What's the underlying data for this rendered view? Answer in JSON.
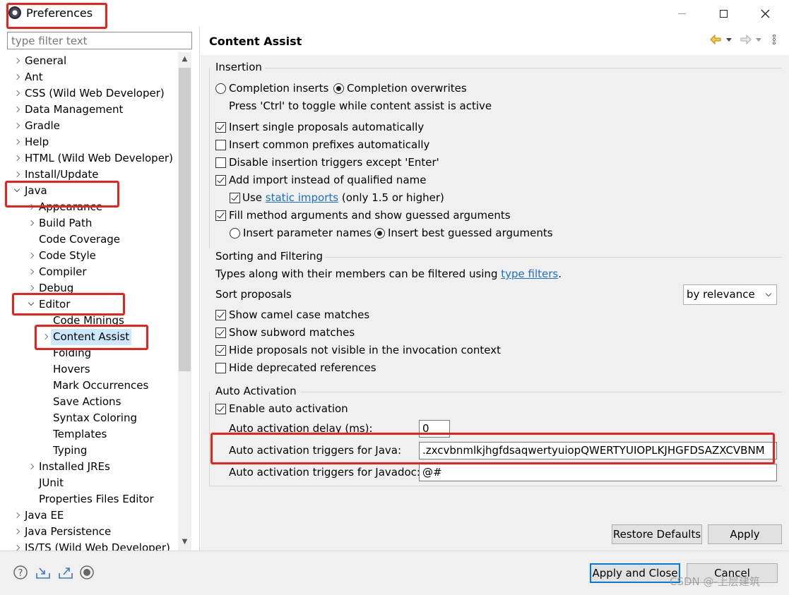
{
  "window": {
    "title": "Preferences",
    "minimize_icon": "minimize-icon",
    "maximize_icon": "maximize-icon",
    "close_icon": "close-icon"
  },
  "filter": {
    "placeholder": "type filter text",
    "value": ""
  },
  "tree": [
    {
      "label": "General",
      "level": 0,
      "toggle": "closed"
    },
    {
      "label": "Ant",
      "level": 0,
      "toggle": "closed"
    },
    {
      "label": "CSS (Wild Web Developer)",
      "level": 0,
      "toggle": "closed"
    },
    {
      "label": "Data Management",
      "level": 0,
      "toggle": "closed"
    },
    {
      "label": "Gradle",
      "level": 0,
      "toggle": "closed"
    },
    {
      "label": "Help",
      "level": 0,
      "toggle": "closed"
    },
    {
      "label": "HTML (Wild Web Developer)",
      "level": 0,
      "toggle": "closed"
    },
    {
      "label": "Install/Update",
      "level": 0,
      "toggle": "closed"
    },
    {
      "label": "Java",
      "level": 0,
      "toggle": "open"
    },
    {
      "label": "Appearance",
      "level": 1,
      "toggle": "closed"
    },
    {
      "label": "Build Path",
      "level": 1,
      "toggle": "closed"
    },
    {
      "label": "Code Coverage",
      "level": 1,
      "toggle": "none"
    },
    {
      "label": "Code Style",
      "level": 1,
      "toggle": "closed"
    },
    {
      "label": "Compiler",
      "level": 1,
      "toggle": "closed"
    },
    {
      "label": "Debug",
      "level": 1,
      "toggle": "closed"
    },
    {
      "label": "Editor",
      "level": 1,
      "toggle": "open"
    },
    {
      "label": "Code Minings",
      "level": 2,
      "toggle": "none"
    },
    {
      "label": "Content Assist",
      "level": 2,
      "toggle": "closed",
      "selected": true
    },
    {
      "label": "Folding",
      "level": 2,
      "toggle": "none"
    },
    {
      "label": "Hovers",
      "level": 2,
      "toggle": "none"
    },
    {
      "label": "Mark Occurrences",
      "level": 2,
      "toggle": "none"
    },
    {
      "label": "Save Actions",
      "level": 2,
      "toggle": "none"
    },
    {
      "label": "Syntax Coloring",
      "level": 2,
      "toggle": "none"
    },
    {
      "label": "Templates",
      "level": 2,
      "toggle": "none"
    },
    {
      "label": "Typing",
      "level": 2,
      "toggle": "none"
    },
    {
      "label": "Installed JREs",
      "level": 1,
      "toggle": "closed"
    },
    {
      "label": "JUnit",
      "level": 1,
      "toggle": "none"
    },
    {
      "label": "Properties Files Editor",
      "level": 1,
      "toggle": "none"
    },
    {
      "label": "Java EE",
      "level": 0,
      "toggle": "closed"
    },
    {
      "label": "Java Persistence",
      "level": 0,
      "toggle": "closed"
    },
    {
      "label": "JS/TS (Wild Web Developer)",
      "level": 0,
      "toggle": "closed"
    }
  ],
  "page": {
    "title": "Content Assist",
    "nav_icons": [
      "back-arrow-icon",
      "back-menu-icon",
      "forward-arrow-icon",
      "forward-menu-icon",
      "view-menu-icon"
    ]
  },
  "insertion": {
    "title": "Insertion",
    "completion_inserts": "Completion inserts",
    "completion_overwrites": "Completion overwrites",
    "toggle_hint": "Press 'Ctrl' to toggle while content assist is active",
    "insert_single": "Insert single proposals automatically",
    "insert_common": "Insert common prefixes automatically",
    "disable_triggers": "Disable insertion triggers except 'Enter'",
    "add_import": "Add import instead of qualified name",
    "use_prefix": "Use ",
    "static_imports": "static imports",
    "use_suffix": " (only 1.5 or higher)",
    "fill_args": "Fill method arguments and show guessed arguments",
    "insert_param_names": "Insert parameter names",
    "insert_best_guess": "Insert best guessed arguments"
  },
  "sorting": {
    "title": "Sorting and Filtering",
    "filter_text_prefix": "Types along with their members can be filtered using ",
    "type_filters": "type filters",
    "filter_text_suffix": ".",
    "sort_label": "Sort proposals",
    "sort_value": "by relevance",
    "camel_case": "Show camel case matches",
    "subword": "Show subword matches",
    "hide_invisible": "Hide proposals not visible in the invocation context",
    "hide_deprecated": "Hide deprecated references"
  },
  "auto_activation": {
    "title": "Auto Activation",
    "enable": "Enable auto activation",
    "delay_label": "Auto activation delay (ms):",
    "delay_value": "0",
    "java_label": "Auto activation triggers for Java:",
    "java_value": ".zxcvbnmlkjhgfdsaqwertyuiopQWERTYUIOPLKJHGFDSAZXCVBNM",
    "javadoc_label": "Auto activation triggers for Javadoc:",
    "javadoc_value": "@#"
  },
  "buttons": {
    "restore": "Restore Defaults",
    "apply": "Apply",
    "apply_close": "Apply and Close",
    "cancel": "Cancel"
  },
  "bottom_icons": [
    "help-icon",
    "import-icon",
    "export-icon",
    "record-icon"
  ],
  "watermark": "CSDN @-上层建筑",
  "colors": {
    "highlight": "#e8231b",
    "link": "#1a6fc7",
    "selection": "#cce8ff",
    "default_button": "#0078d7"
  }
}
